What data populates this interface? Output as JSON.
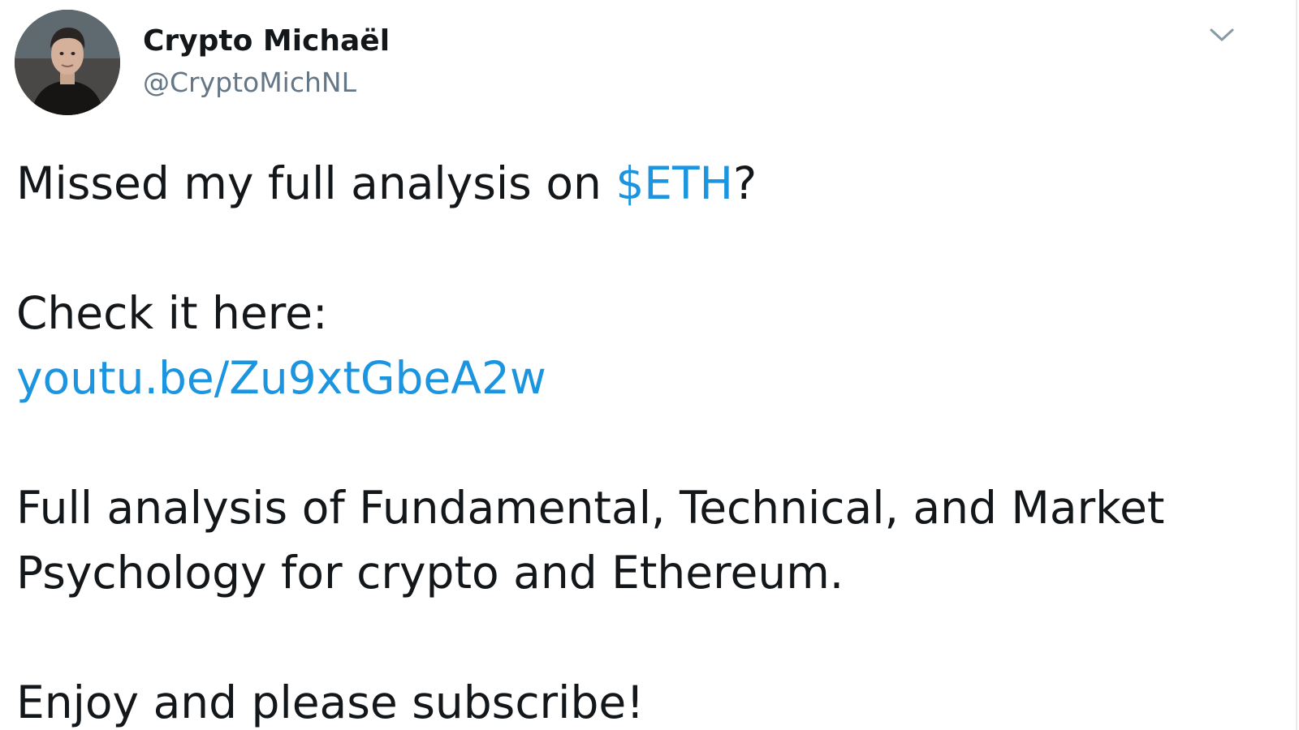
{
  "tweet": {
    "author": {
      "display_name": "Crypto Michaël",
      "handle": "@CryptoMichNL"
    },
    "menu_icon": "chevron-down-icon",
    "text": {
      "line1_prefix": "Missed my full analysis on ",
      "cashtag": "$ETH",
      "line1_suffix": "?",
      "line3": "Check it here:",
      "link": "youtu.be/Zu9xtGbeA2w",
      "line6": "Full analysis of Fundamental, Technical, and Market",
      "line7": "Psychology for crypto and Ethereum.",
      "line9": "Enjoy and please subscribe!"
    },
    "colors": {
      "link": "#1b95e0",
      "text": "#14171a",
      "handle": "#657786"
    }
  }
}
